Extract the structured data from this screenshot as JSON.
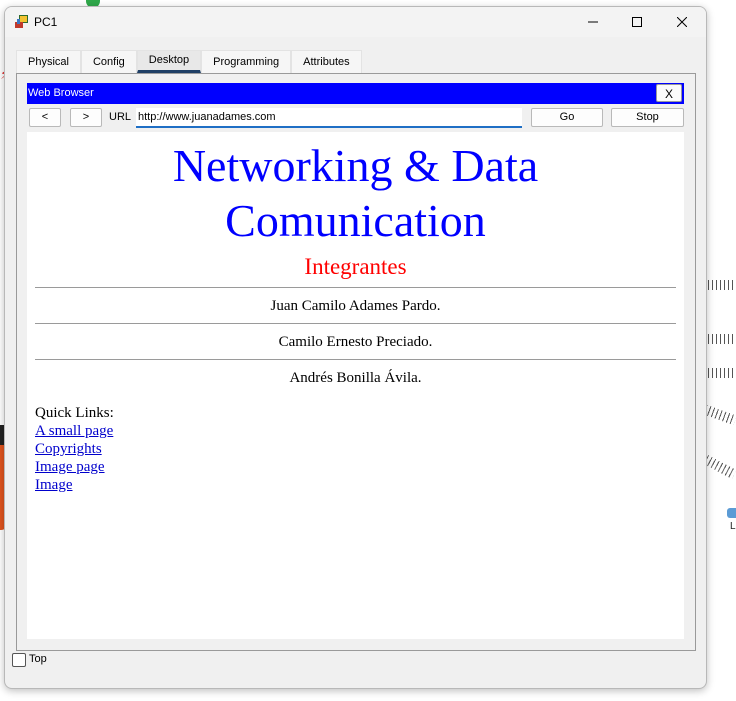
{
  "window": {
    "title": "PC1"
  },
  "tabs": [
    {
      "label": "Physical"
    },
    {
      "label": "Config"
    },
    {
      "label": "Desktop"
    },
    {
      "label": "Programming"
    },
    {
      "label": "Attributes"
    }
  ],
  "browser": {
    "title": "Web Browser",
    "close_label": "X",
    "back_label": "<",
    "forward_label": ">",
    "url_label": "URL",
    "url_value": "http://www.juanadames.com",
    "go_label": "Go",
    "stop_label": "Stop"
  },
  "webpage": {
    "heading_line1": "Networking & Data",
    "heading_line2": "Comunication",
    "subtitle": "Integrantes",
    "members": [
      "Juan Camilo Adames Pardo.",
      "Camilo Ernesto Preciado.",
      "Andrés Bonilla Ávila."
    ],
    "quick_links_label": "Quick Links:",
    "links": [
      "A small page",
      "Copyrights",
      "Image page",
      "Image"
    ]
  },
  "footer": {
    "top_label": "Top"
  },
  "workspace": {
    "partial_label": "L"
  },
  "colors": {
    "accent_blue": "#0000ff",
    "heading_red": "#ff0000",
    "link_blue": "#0000cc",
    "tab_active": "#1f3f66"
  }
}
